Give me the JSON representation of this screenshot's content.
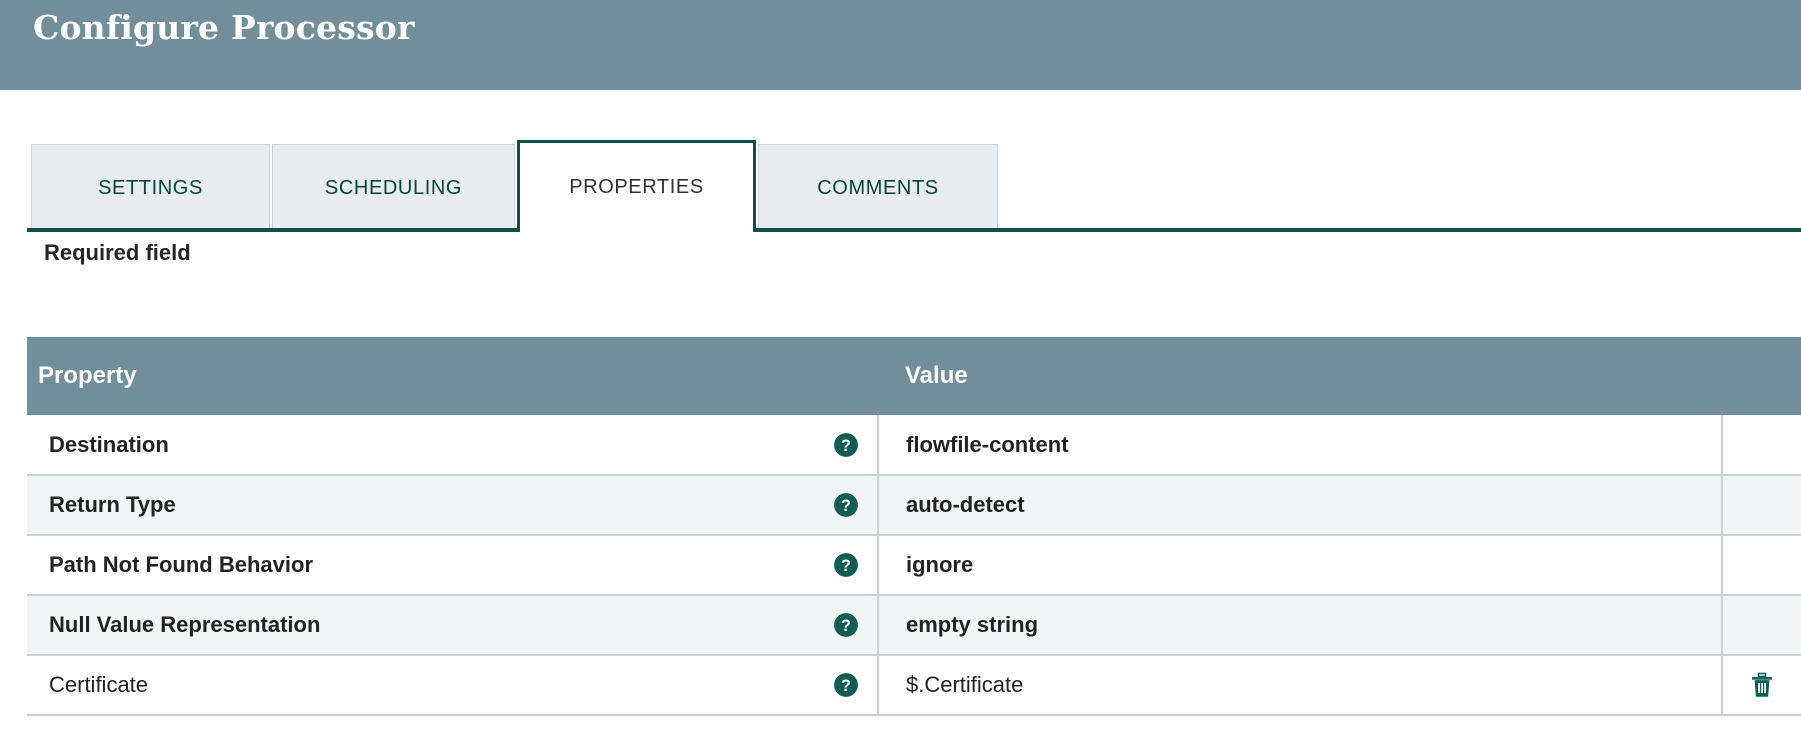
{
  "dialog": {
    "title": "Configure Processor"
  },
  "tabs": [
    {
      "label": "SETTINGS",
      "active": false
    },
    {
      "label": "SCHEDULING",
      "active": false
    },
    {
      "label": "PROPERTIES",
      "active": true
    },
    {
      "label": "COMMENTS",
      "active": false
    }
  ],
  "properties_panel": {
    "required_field_label": "Required field",
    "columns": {
      "property": "Property",
      "value": "Value",
      "actions": ""
    },
    "rows": [
      {
        "property": "Destination",
        "value": "flowfile-content",
        "required": true,
        "help_icon": "help-circle-icon",
        "delete_icon": null
      },
      {
        "property": "Return Type",
        "value": "auto-detect",
        "required": true,
        "help_icon": "help-circle-icon",
        "delete_icon": null
      },
      {
        "property": "Path Not Found Behavior",
        "value": "ignore",
        "required": true,
        "help_icon": "help-circle-icon",
        "delete_icon": null
      },
      {
        "property": "Null Value Representation",
        "value": "empty string",
        "required": true,
        "help_icon": "help-circle-icon",
        "delete_icon": null
      },
      {
        "property": "Certificate",
        "value": "$.Certificate",
        "required": false,
        "help_icon": "help-circle-icon",
        "delete_icon": "trash-icon"
      }
    ]
  },
  "colors": {
    "header_bar": "#728e9b",
    "table_header": "#728e9b",
    "accent_teal": "#124f49",
    "icon_teal": "#115c55",
    "tab_inactive_bg": "#e8ecef",
    "row_alt_bg": "#f2f5f6",
    "grid_line": "#c6d2d7"
  }
}
